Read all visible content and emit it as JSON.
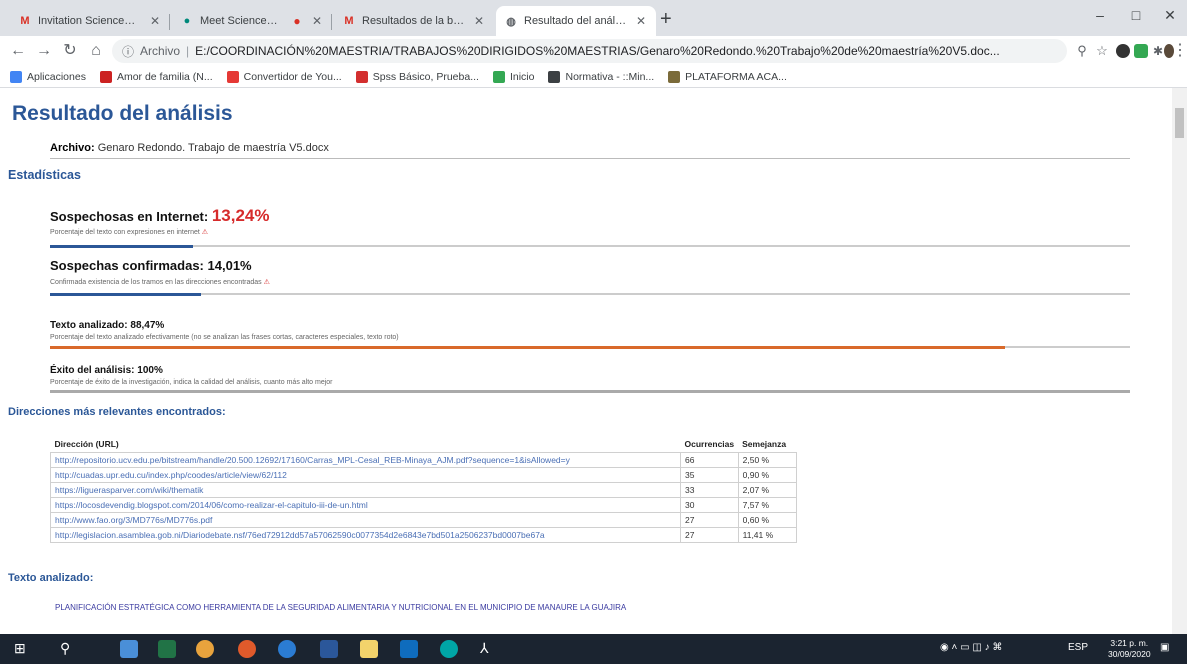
{
  "tabs": [
    {
      "title": "Invitation ScienceDirect y Scop...",
      "icon": "gmail-icon"
    },
    {
      "title": "Meet ScienceDirect y Scop...",
      "icon": "meet-icon"
    },
    {
      "title": "Resultados de la búsqueda - ...",
      "icon": "gmail-icon"
    },
    {
      "title": "Resultado del análisis",
      "icon": "globe-icon"
    }
  ],
  "window": {
    "minimize": "–",
    "maximize": "□",
    "close": "✕"
  },
  "omnibox": {
    "protocol": "Archivo",
    "url": "E:/COORDINACIÓN%20MAESTRIA/TRABAJOS%20DIRIGIDOS%20MAESTRIAS/Genaro%20Redondo.%20Trabajo%20de%20maestría%20V5.doc..."
  },
  "bookmarks": [
    {
      "label": "Aplicaciones",
      "color": "#4285f4"
    },
    {
      "label": "Amor de familia (N...",
      "color": "#cc2222"
    },
    {
      "label": "Convertidor de You...",
      "color": "#e53935"
    },
    {
      "label": "Spss Básico, Prueba...",
      "color": "#d32f2f"
    },
    {
      "label": "Inicio",
      "color": "#34a853"
    },
    {
      "label": "Normativa - ::Min...",
      "color": "#3c4043"
    },
    {
      "label": "PLATAFORMA ACA...",
      "color": "#7b6b3a"
    }
  ],
  "page": {
    "title": "Resultado del análisis",
    "archivo_label": "Archivo:",
    "archivo_value": "Genaro Redondo. Trabajo de maestría V5.docx",
    "estadisticas": "Estadísticas",
    "stats": {
      "internet": {
        "title": "Sospechosas en Internet:",
        "value": "13,24%",
        "desc": "Porcentaje del texto con expresiones en internet",
        "fraction": 0.1324,
        "color": "#2b5797"
      },
      "confirmadas": {
        "title": "Sospechas confirmadas:",
        "value": "14,01%",
        "desc": "Confirmada existencia de los tramos en las direcciones encontradas",
        "fraction": 0.1401,
        "color": "#2b5797"
      },
      "analizado": {
        "title": "Texto analizado:",
        "value": "88,47%",
        "desc": "Porcentaje del texto analizado efectivamente (no se analizan las frases cortas, caracteres especiales, texto roto)",
        "fraction": 0.8847,
        "color": "#d9692a"
      },
      "exito": {
        "title": "Éxito del análisis:",
        "value": "100%",
        "desc": "Porcentaje de éxito de la investigación, indica la calidad del análisis, cuanto más alto mejor",
        "fraction": 1.0,
        "color": "#aaaaaa"
      }
    },
    "direcciones_heading": "Direcciones más relevantes encontrados:",
    "table": {
      "headers": [
        "Dirección (URL)",
        "Ocurrencias",
        "Semejanza"
      ],
      "rows": [
        [
          "http://repositorio.ucv.edu.pe/bitstream/handle/20.500.12692/17160/Carras_MPL-Cesal_REB-Minaya_AJM.pdf?sequence=1&isAllowed=y",
          "66",
          "2,50 %"
        ],
        [
          "http://cuadas.upr.edu.cu/index.php/coodes/article/view/62/112",
          "35",
          "0,90 %"
        ],
        [
          "https://liguerasparver.com/wiki/thematik",
          "33",
          "2,07 %"
        ],
        [
          "https://locosdevendig.blogspot.com/2014/06/como-realizar-el-capitulo-iii-de-un.html",
          "30",
          "7,57 %"
        ],
        [
          "http://www.fao.org/3/MD776s/MD776s.pdf",
          "27",
          "0,60 %"
        ],
        [
          "http://legislacion.asamblea.gob.ni/Diariodebate.nsf/76ed72912dd57a57062590c0077354d2e6843e7bd501a2506237bd0007be67a",
          "27",
          "11,41 %"
        ]
      ]
    },
    "texto_heading": "Texto analizado:",
    "texto_body": "PLANIFICACIÓN ESTRATÉGICA COMO HERRAMIENTA DE LA SEGURIDAD ALIMENTARIA Y NUTRICIONAL EN EL MUNICIPIO DE MANAURE LA GUAJIRA"
  },
  "taskbar": {
    "lang": "ESP",
    "time": "3:21 p. m.",
    "date": "30/09/2020"
  }
}
